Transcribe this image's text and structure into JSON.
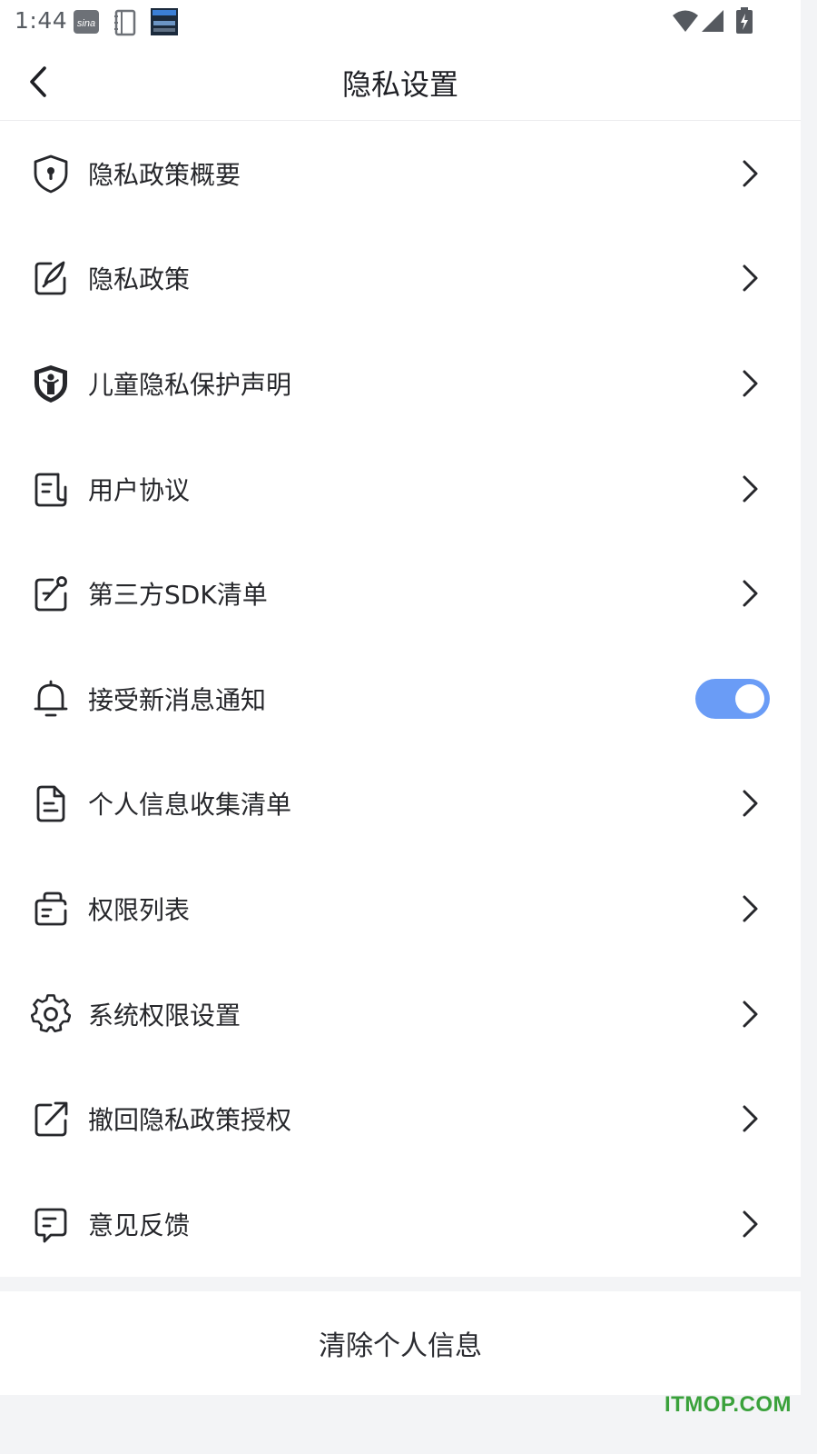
{
  "status_bar": {
    "time": "1:44",
    "notification_icons": [
      "sina-icon",
      "notebook-icon",
      "clock-widget-icon"
    ],
    "system_icons": [
      "wifi-icon",
      "signal-icon",
      "battery-charging-icon"
    ]
  },
  "header": {
    "title": "隐私设置",
    "back_icon": "back-arrow-icon"
  },
  "menu": {
    "items": [
      {
        "label": "隐私政策概要",
        "icon": "shield-lock-icon",
        "action": "chevron"
      },
      {
        "label": "隐私政策",
        "icon": "edit-document-icon",
        "action": "chevron"
      },
      {
        "label": "儿童隐私保护声明",
        "icon": "child-shield-icon",
        "action": "chevron"
      },
      {
        "label": "用户协议",
        "icon": "agreement-doc-icon",
        "action": "chevron"
      },
      {
        "label": "第三方SDK清单",
        "icon": "sdk-list-icon",
        "action": "chevron"
      },
      {
        "label": "接受新消息通知",
        "icon": "bell-icon",
        "action": "toggle",
        "toggle_on": true
      },
      {
        "label": "个人信息收集清单",
        "icon": "file-list-icon",
        "action": "chevron"
      },
      {
        "label": "权限列表",
        "icon": "briefcase-list-icon",
        "action": "chevron"
      },
      {
        "label": "系统权限设置",
        "icon": "gear-icon",
        "action": "chevron"
      },
      {
        "label": "撤回隐私政策授权",
        "icon": "export-revoke-icon",
        "action": "chevron"
      },
      {
        "label": "意见反馈",
        "icon": "feedback-chat-icon",
        "action": "chevron"
      }
    ]
  },
  "clear_button": {
    "label": "清除个人信息"
  },
  "watermark": "ITMOP.COM",
  "colors": {
    "toggle_on": "#6a9cf6",
    "background": "#f3f4f6",
    "watermark": "#3aa13b"
  }
}
